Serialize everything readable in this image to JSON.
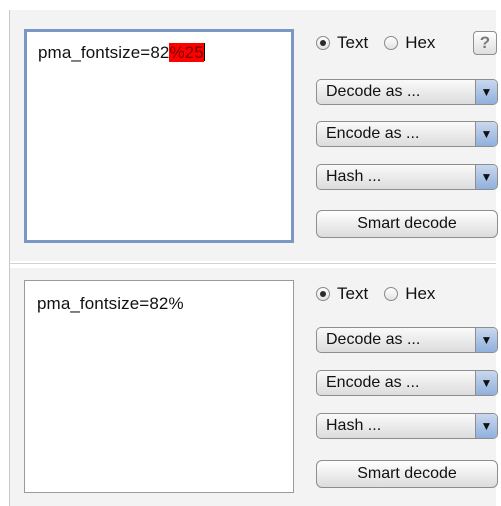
{
  "top": {
    "text_plain": "pma_fontsize=82",
    "text_highlight": "%25",
    "radio_text": "Text",
    "radio_hex": "Hex",
    "help": "?",
    "decode_label": "Decode as ...",
    "encode_label": "Encode as ...",
    "hash_label": "Hash ...",
    "smart_decode": "Smart decode"
  },
  "bottom": {
    "text": "pma_fontsize=82%",
    "radio_text": "Text",
    "radio_hex": "Hex",
    "decode_label": "Decode as ...",
    "encode_label": "Encode as ...",
    "hash_label": "Hash ...",
    "smart_decode": "Smart decode"
  },
  "icons": {
    "dropdown_arrow": "▼"
  },
  "colors": {
    "highlight": "#ff0000",
    "focus_border": "#7b97c4"
  }
}
